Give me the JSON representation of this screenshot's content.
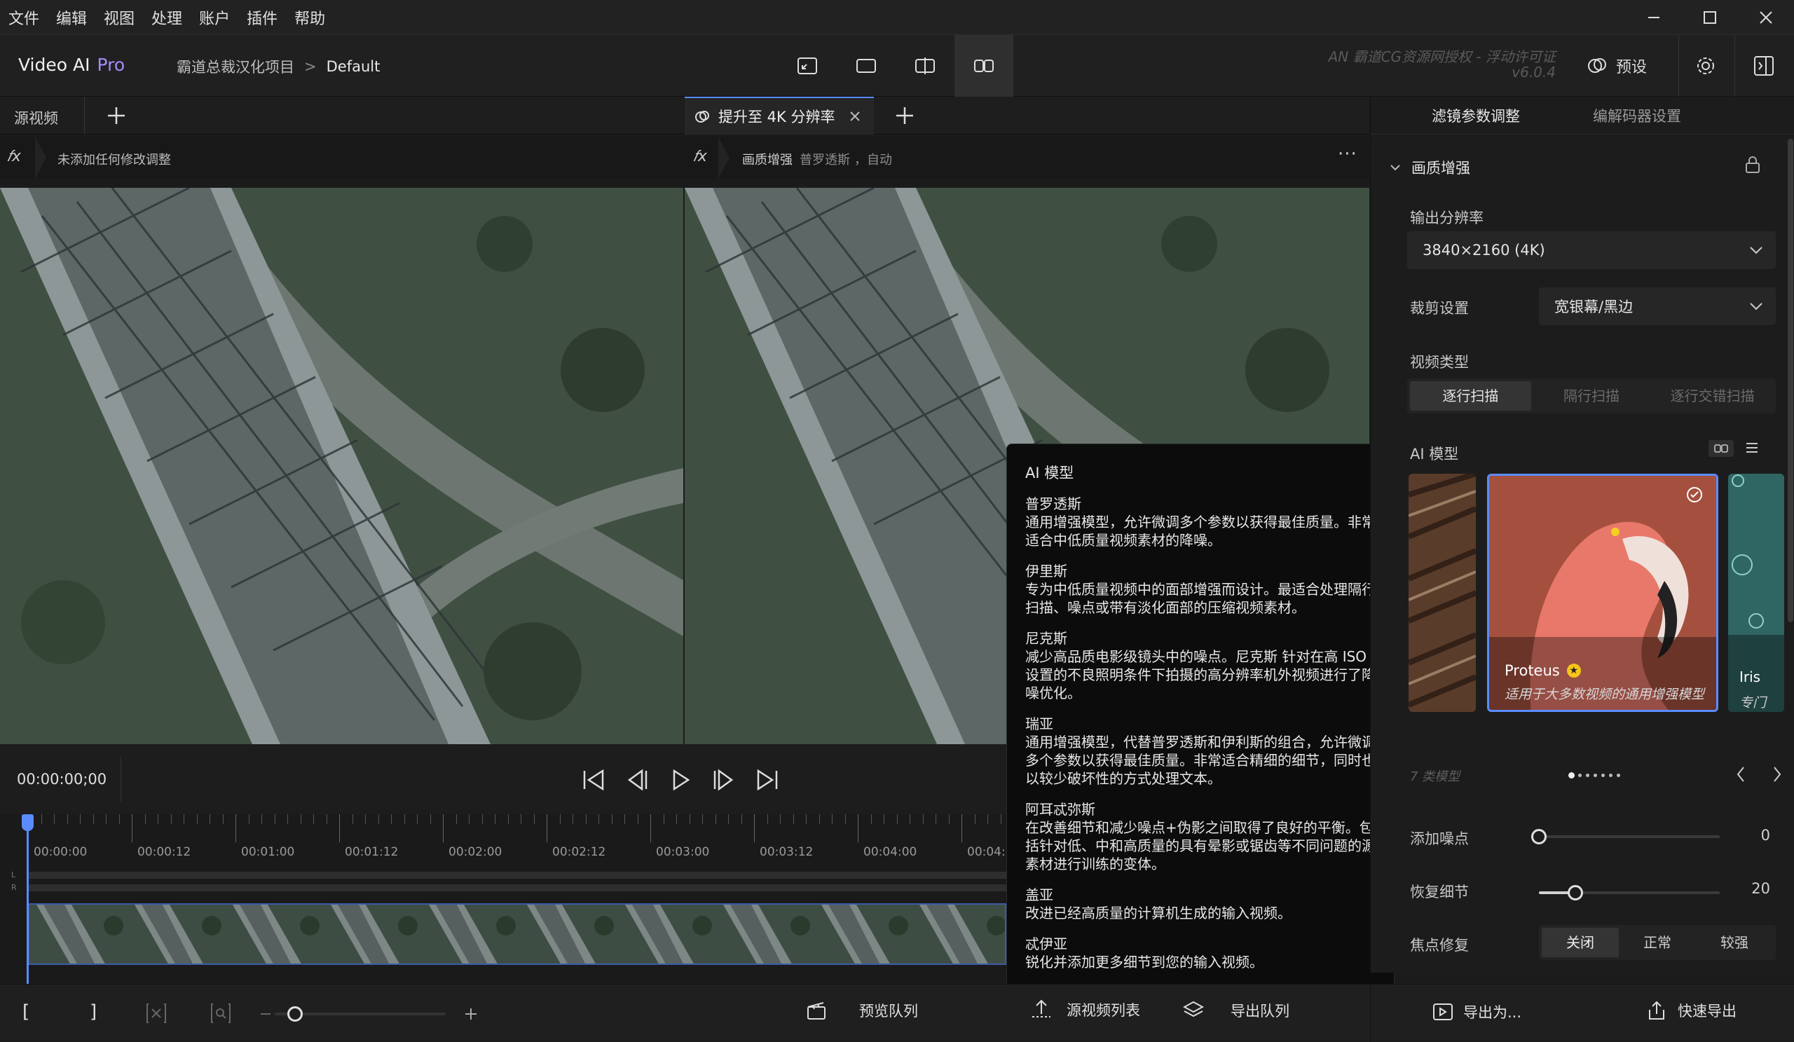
{
  "menu": [
    "文件",
    "编辑",
    "视图",
    "处理",
    "账户",
    "插件",
    "帮助"
  ],
  "app": {
    "name": "Video AI",
    "edition": "Pro"
  },
  "breadcrumb": {
    "project": "霸道总裁汉化项目",
    "separator": ">",
    "current": "Default"
  },
  "watermark": {
    "line1": "AN 霸道CG资源网授权 - 浮动许可证",
    "version": "v6.0.4"
  },
  "header": {
    "preset_label": "预设"
  },
  "left_pane": {
    "tab_label": "源视频",
    "fx_text": "未添加任何修改调整"
  },
  "right_pane": {
    "tab_label": "提升至 4K 分辨率",
    "fx_name": "画质增强",
    "fx_model": "普罗透斯",
    "fx_mode": "，自动"
  },
  "transport": {
    "timecode": "00:00:00;00"
  },
  "timeline": {
    "labels": [
      "00:00:00",
      "00:00:12",
      "00:01:00",
      "00:01:12",
      "00:02:00",
      "00:02:12",
      "00:03:00",
      "00:03:12",
      "00:04:00",
      "00:04:"
    ],
    "channel_l": "L",
    "channel_r": "R"
  },
  "panel": {
    "tabs": [
      "滤镜参数调整",
      "编解码器设置"
    ],
    "section_title": "画质增强",
    "output_res_label": "输出分辨率",
    "output_res_value": "3840×2160 (4K)",
    "crop_label": "裁剪设置",
    "crop_value": "宽银幕/黑边",
    "video_type_label": "视频类型",
    "video_types": [
      "逐行扫描",
      "隔行扫描",
      "逐行交错扫描"
    ],
    "ai_model_label": "AI 模型",
    "selected_model": {
      "name": "Proteus",
      "desc": "适用于大多数视频的通用增强模型"
    },
    "next_model": {
      "name": "Iris",
      "desc": "专门"
    },
    "model_count": "7 类模型",
    "add_noise_label": "添加噪点",
    "add_noise_value": "0",
    "add_noise_level": 0,
    "recover_detail_label": "恢复细节",
    "recover_detail_value": "20",
    "recover_detail_level": 0.2,
    "focus_fix_label": "焦点修复",
    "focus_fix_options": [
      "关闭",
      "正常",
      "较强"
    ]
  },
  "tooltip": {
    "title": "AI 模型",
    "items": [
      {
        "name": "普罗透斯",
        "desc": "通用增强模型，允许微调多个参数以获得最佳质量。非常适合中低质量视频素材的降噪。"
      },
      {
        "name": "伊里斯",
        "desc": "专为中低质量视频中的面部增强而设计。最适合处理隔行扫描、噪点或带有淡化面部的压缩视频素材。"
      },
      {
        "name": "尼克斯",
        "desc": "减少高品质电影级镜头中的噪点。尼克斯 针对在高 ISO 设置的不良照明条件下拍摄的高分辨率机外视频进行了降噪优化。"
      },
      {
        "name": "瑞亚",
        "desc": "通用增强模型，代替普罗透斯和伊利斯的组合，允许微调多个参数以获得最佳质量。非常适合精细的细节，同时也以较少破坏性的方式处理文本。"
      },
      {
        "name": "阿耳忒弥斯",
        "desc": "在改善细节和减少噪点+伪影之间取得了良好的平衡。包括针对低、中和高质量的具有晕影或锯齿等不同问题的源素材进行训练的变体。"
      },
      {
        "name": "盖亚",
        "desc": "改进已经高质量的计算机生成的输入视频。"
      },
      {
        "name": "忒伊亚",
        "desc": "锐化并添加更多细节到您的输入视频。"
      }
    ]
  },
  "bottom": {
    "bracket_in": "[",
    "bracket_out": "]",
    "zoom_level": 0.12,
    "preview_queue": "预览队列",
    "source_list": "源视频列表",
    "export_queue": "导出队列",
    "export_as": "导出为...",
    "quick_export": "快速导出"
  },
  "colors": {
    "accent": "#5b8cff",
    "brand_pro": "#a78bfa",
    "star": "#f5c518"
  }
}
